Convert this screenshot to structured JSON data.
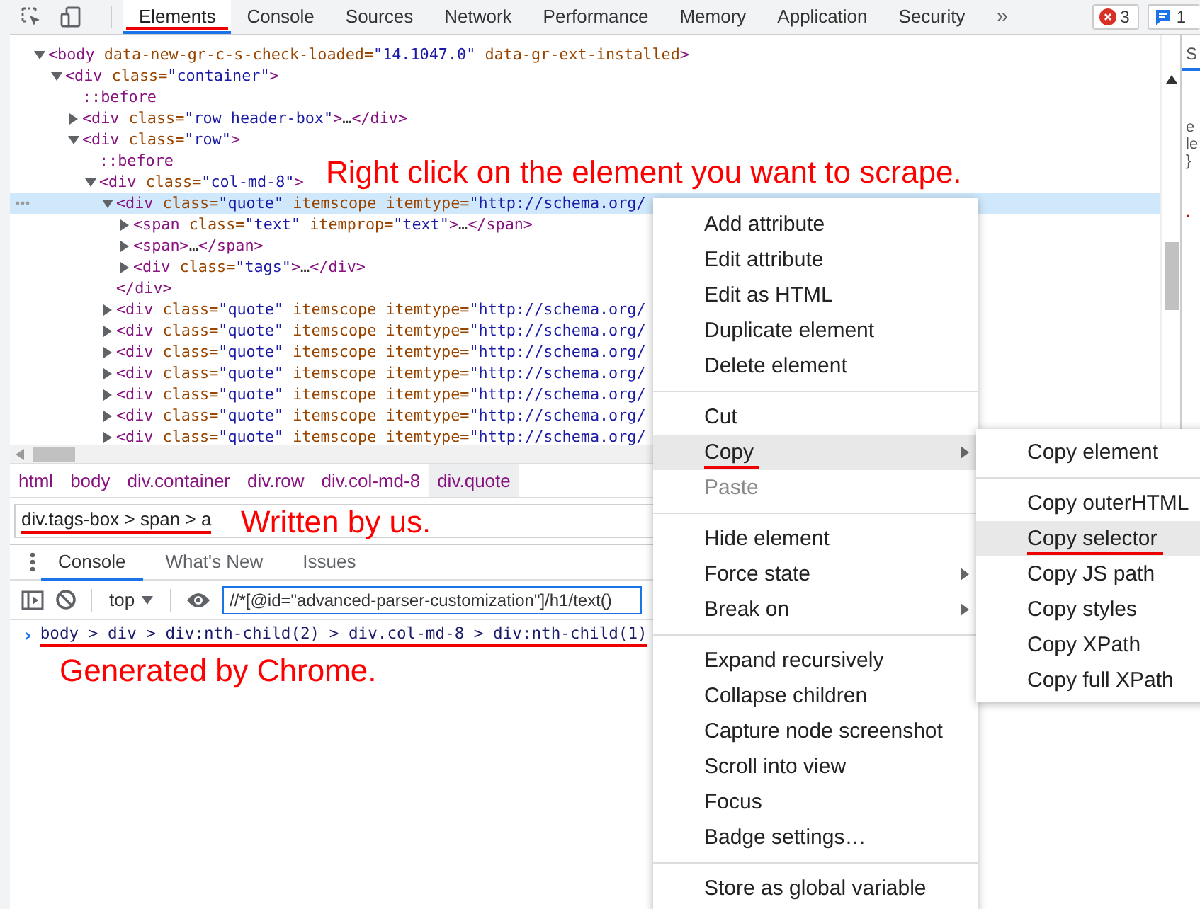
{
  "toolbar": {
    "tabs": [
      {
        "label": "Elements",
        "selected": true,
        "underlined": true
      },
      {
        "label": "Console",
        "selected": false,
        "underlined": false
      },
      {
        "label": "Sources",
        "selected": false,
        "underlined": false
      },
      {
        "label": "Network",
        "selected": false,
        "underlined": false
      },
      {
        "label": "Performance",
        "selected": false,
        "underlined": false
      },
      {
        "label": "Memory",
        "selected": false,
        "underlined": false
      },
      {
        "label": "Application",
        "selected": false,
        "underlined": false
      },
      {
        "label": "Security",
        "selected": false,
        "underlined": false
      }
    ],
    "overflow": "»",
    "errors": "3",
    "messages": "1"
  },
  "dom": [
    {
      "text": "<body data-new-gr-c-s-check-loaded=\"14.1047.0\" data-gr-ext-installed>",
      "expanded": true,
      "selected": false,
      "children": [
        {
          "text": "<div class=\"container\">",
          "expanded": true,
          "selected": false,
          "children": [
            {
              "text": "::before",
              "selected": false
            },
            {
              "text": "<div class=\"row header-box\">…</div>",
              "expanded": false,
              "selected": false
            },
            {
              "text": "<div class=\"row\">",
              "expanded": true,
              "selected": false,
              "children": [
                {
                  "text": "::before",
                  "selected": false
                },
                {
                  "text": "<div class=\"col-md-8\">",
                  "expanded": true,
                  "selected": false,
                  "children": [
                    {
                      "text": "<div class=\"quote\" itemscope itemtype=\"http://schema.org/",
                      "expanded": true,
                      "selected": true,
                      "closing": "</div>",
                      "children": [
                        {
                          "text": "<span class=\"text\" itemprop=\"text\">…</span>",
                          "expanded": false,
                          "selected": false
                        },
                        {
                          "text": "<span>…</span>",
                          "expanded": false,
                          "selected": false
                        },
                        {
                          "text": "<div class=\"tags\">…</div>",
                          "expanded": false,
                          "selected": false
                        }
                      ]
                    },
                    {
                      "text": "<div class=\"quote\" itemscope itemtype=\"http://schema.org/",
                      "expanded": false,
                      "selected": false
                    },
                    {
                      "text": "<div class=\"quote\" itemscope itemtype=\"http://schema.org/",
                      "expanded": false,
                      "selected": false
                    },
                    {
                      "text": "<div class=\"quote\" itemscope itemtype=\"http://schema.org/",
                      "expanded": false,
                      "selected": false
                    },
                    {
                      "text": "<div class=\"quote\" itemscope itemtype=\"http://schema.org/",
                      "expanded": false,
                      "selected": false
                    },
                    {
                      "text": "<div class=\"quote\" itemscope itemtype=\"http://schema.org/",
                      "expanded": false,
                      "selected": false
                    },
                    {
                      "text": "<div class=\"quote\" itemscope itemtype=\"http://schema.org/",
                      "expanded": false,
                      "selected": false
                    },
                    {
                      "text": "<div class=\"quote\" itemscope itemtype=\"http://schema.org/",
                      "expanded": false,
                      "selected": false
                    }
                  ]
                }
              ]
            }
          ]
        }
      ]
    }
  ],
  "side_panel": {
    "tab": "S",
    "lines": [
      "e",
      "le",
      "}"
    ],
    "rule": "."
  },
  "breadcrumbs": [
    {
      "label": "html",
      "selected": false
    },
    {
      "label": "body",
      "selected": false
    },
    {
      "label": "div.container",
      "selected": false
    },
    {
      "label": "div.row",
      "selected": false
    },
    {
      "label": "div.col-md-8",
      "selected": false
    },
    {
      "label": "div.quote",
      "selected": true
    }
  ],
  "search": {
    "value": "div.tags-box > span > a",
    "underlined": true
  },
  "drawer": {
    "tabs": [
      {
        "label": "Console",
        "selected": true
      },
      {
        "label": "What's New",
        "selected": false
      },
      {
        "label": "Issues",
        "selected": false
      }
    ],
    "context": "top",
    "filter": "//*[@id=\"advanced-parser-customization\"]/h1/text()",
    "prompt": "›",
    "entry": "body > div > div:nth-child(2) > div.col-md-8 > div:nth-child(1)",
    "entry_underlined": true
  },
  "annotations": [
    {
      "text": "Right click on the element you want to scrape."
    },
    {
      "text": "Written by us."
    },
    {
      "text": "Generated by Chrome."
    }
  ],
  "context_menu": {
    "groups": [
      [
        {
          "label": "Add attribute",
          "submenu": false,
          "disabled": false,
          "selected": false,
          "underlined": false
        },
        {
          "label": "Edit attribute",
          "submenu": false,
          "disabled": false,
          "selected": false,
          "underlined": false
        },
        {
          "label": "Edit as HTML",
          "submenu": false,
          "disabled": false,
          "selected": false,
          "underlined": false
        },
        {
          "label": "Duplicate element",
          "submenu": false,
          "disabled": false,
          "selected": false,
          "underlined": false
        },
        {
          "label": "Delete element",
          "submenu": false,
          "disabled": false,
          "selected": false,
          "underlined": false
        }
      ],
      [
        {
          "label": "Cut",
          "submenu": false,
          "disabled": false,
          "selected": false,
          "underlined": false
        },
        {
          "label": "Copy",
          "submenu": true,
          "disabled": false,
          "selected": true,
          "underlined": true
        },
        {
          "label": "Paste",
          "submenu": false,
          "disabled": true,
          "selected": false,
          "underlined": false
        }
      ],
      [
        {
          "label": "Hide element",
          "submenu": false,
          "disabled": false,
          "selected": false,
          "underlined": false
        },
        {
          "label": "Force state",
          "submenu": true,
          "disabled": false,
          "selected": false,
          "underlined": false
        },
        {
          "label": "Break on",
          "submenu": true,
          "disabled": false,
          "selected": false,
          "underlined": false
        }
      ],
      [
        {
          "label": "Expand recursively",
          "submenu": false,
          "disabled": false,
          "selected": false,
          "underlined": false
        },
        {
          "label": "Collapse children",
          "submenu": false,
          "disabled": false,
          "selected": false,
          "underlined": false
        },
        {
          "label": "Capture node screenshot",
          "submenu": false,
          "disabled": false,
          "selected": false,
          "underlined": false
        },
        {
          "label": "Scroll into view",
          "submenu": false,
          "disabled": false,
          "selected": false,
          "underlined": false
        },
        {
          "label": "Focus",
          "submenu": false,
          "disabled": false,
          "selected": false,
          "underlined": false
        },
        {
          "label": "Badge settings…",
          "submenu": false,
          "disabled": false,
          "selected": false,
          "underlined": false
        }
      ],
      [
        {
          "label": "Store as global variable",
          "submenu": false,
          "disabled": false,
          "selected": false,
          "underlined": false
        }
      ]
    ]
  },
  "submenu": {
    "groups": [
      [
        {
          "label": "Copy element",
          "disabled": false,
          "selected": false,
          "underlined": false
        }
      ],
      [
        {
          "label": "Copy outerHTML",
          "disabled": false,
          "selected": false,
          "underlined": false
        },
        {
          "label": "Copy selector",
          "disabled": false,
          "selected": true,
          "underlined": true
        },
        {
          "label": "Copy JS path",
          "disabled": false,
          "selected": false,
          "underlined": false
        },
        {
          "label": "Copy styles",
          "disabled": false,
          "selected": false,
          "underlined": false
        },
        {
          "label": "Copy XPath",
          "disabled": false,
          "selected": false,
          "underlined": false
        },
        {
          "label": "Copy full XPath",
          "disabled": false,
          "selected": false,
          "underlined": false
        }
      ]
    ]
  }
}
